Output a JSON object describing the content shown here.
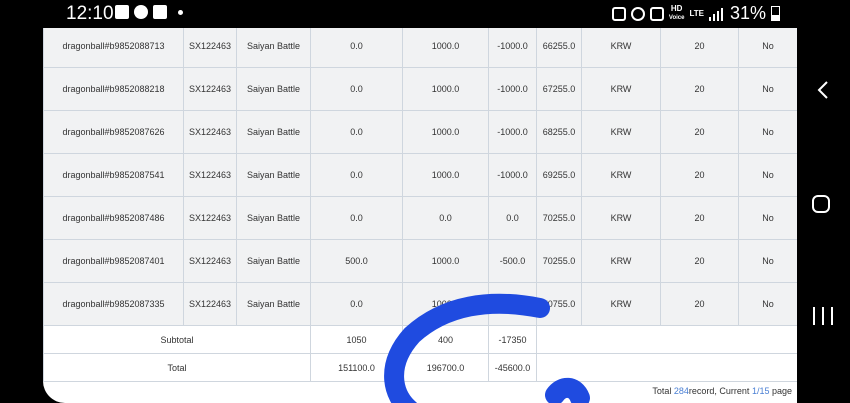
{
  "status_bar": {
    "time": "12:10",
    "left_icons": [
      "gallery-icon",
      "talk-icon",
      "message-icon"
    ],
    "right_icons": [
      "vibrate-icon",
      "alarm-icon",
      "mute-icon"
    ],
    "network_top": "HD",
    "network_bottom": "Voice",
    "lte_label": "LTE",
    "battery": "31%"
  },
  "table": {
    "rows": [
      {
        "account": "dragonball#b9852088713",
        "code": "SX122463",
        "game": "Saiyan Battle",
        "c1": "0.0",
        "c2": "1000.0",
        "c3": "-1000.0",
        "balance": "66255.0",
        "currency": "KRW",
        "num": "20",
        "flag": "No"
      },
      {
        "account": "dragonball#b9852088218",
        "code": "SX122463",
        "game": "Saiyan Battle",
        "c1": "0.0",
        "c2": "1000.0",
        "c3": "-1000.0",
        "balance": "67255.0",
        "currency": "KRW",
        "num": "20",
        "flag": "No"
      },
      {
        "account": "dragonball#b9852087626",
        "code": "SX122463",
        "game": "Saiyan Battle",
        "c1": "0.0",
        "c2": "1000.0",
        "c3": "-1000.0",
        "balance": "68255.0",
        "currency": "KRW",
        "num": "20",
        "flag": "No"
      },
      {
        "account": "dragonball#b9852087541",
        "code": "SX122463",
        "game": "Saiyan Battle",
        "c1": "0.0",
        "c2": "1000.0",
        "c3": "-1000.0",
        "balance": "69255.0",
        "currency": "KRW",
        "num": "20",
        "flag": "No"
      },
      {
        "account": "dragonball#b9852087486",
        "code": "SX122463",
        "game": "Saiyan Battle",
        "c1": "0.0",
        "c2": "0.0",
        "c3": "0.0",
        "balance": "70255.0",
        "currency": "KRW",
        "num": "20",
        "flag": "No"
      },
      {
        "account": "dragonball#b9852087401",
        "code": "SX122463",
        "game": "Saiyan Battle",
        "c1": "500.0",
        "c2": "1000.0",
        "c3": "-500.0",
        "balance": "70255.0",
        "currency": "KRW",
        "num": "20",
        "flag": "No"
      },
      {
        "account": "dragonball#b9852087335",
        "code": "SX122463",
        "game": "Saiyan Battle",
        "c1": "0.0",
        "c2": "1000.0",
        "c3": "",
        "balance": "70755.0",
        "currency": "KRW",
        "num": "20",
        "flag": "No"
      }
    ],
    "subtotal": {
      "label": "Subtotal",
      "c1": "1050",
      "c2": "400",
      "c3": "-17350"
    },
    "total": {
      "label": "Total",
      "c1": "151100.0",
      "c2": "196700.0",
      "c3": "-45600.0"
    }
  },
  "pagination": {
    "prefix": "Total ",
    "count": "284",
    "middle": "record, Current ",
    "current": "1/15",
    "suffix": " page"
  },
  "annotation_color": "#1f4be0",
  "colors": {
    "cell_bg": "#f1f2f3",
    "border": "#cfd6de",
    "link": "#4a7fd4"
  }
}
